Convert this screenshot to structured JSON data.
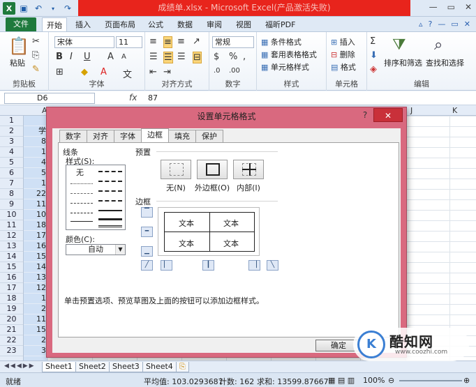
{
  "window": {
    "title": "成绩单.xlsx - Microsoft Excel(产品激活失败)"
  },
  "ribbon": {
    "file_tab": "文件",
    "tabs": [
      "开始",
      "插入",
      "页面布局",
      "公式",
      "数据",
      "审阅",
      "视图",
      "福昕PDF"
    ],
    "clipboard": {
      "paste": "粘贴",
      "label": "剪贴板"
    },
    "font": {
      "family": "宋体",
      "size": "11",
      "bold": "B",
      "italic": "I",
      "underline": "U",
      "grow": "A",
      "shrink": "A",
      "label": "字体"
    },
    "align": {
      "label": "对齐方式"
    },
    "number": {
      "format": "常规",
      "label": "数字"
    },
    "styles": {
      "conditional": "条件格式",
      "table": "套用表格格式",
      "cell": "单元格样式",
      "label": "样式"
    },
    "cells": {
      "insert": "插入",
      "delete": "删除",
      "format": "格式",
      "label": "单元格"
    },
    "edit": {
      "sort": "排序和筛选",
      "find": "查找和选择",
      "label": "编辑"
    }
  },
  "formula_bar": {
    "cell": "D6",
    "fx": "fx",
    "value": "87"
  },
  "sheet": {
    "columns": [
      "A",
      "J",
      "K"
    ],
    "rows": [
      "1",
      "2",
      "3",
      "4",
      "5",
      "6",
      "7",
      "8",
      "9",
      "10",
      "11",
      "12",
      "13",
      "14",
      "15",
      "16",
      "17",
      "18",
      "19",
      "20",
      "21",
      "22",
      "23"
    ],
    "col_a": [
      "",
      "学",
      "8",
      "1",
      "4",
      "5",
      "1",
      "22",
      "11",
      "10",
      "18",
      "17",
      "16",
      "15",
      "14",
      "13",
      "12",
      "1",
      "2",
      "11",
      "15",
      "2",
      "3"
    ],
    "tabs": [
      "Sheet1",
      "Sheet2",
      "Sheet3",
      "Sheet4"
    ]
  },
  "status": {
    "ready": "就绪",
    "average": "平均值: 103.0293687",
    "count": "计数: 162",
    "sum": "求和: 13599.87667",
    "zoom": "100%"
  },
  "dialog": {
    "title": "设置单元格格式",
    "help": "?",
    "close": "✕",
    "tabs": [
      "数字",
      "对齐",
      "字体",
      "边框",
      "填充",
      "保护"
    ],
    "active_tab": "边框",
    "line_section": "线条",
    "style_label": "样式(S):",
    "style_none": "无",
    "color_label": "颜色(C):",
    "color_value": "自动",
    "preset_section": "预置",
    "presets": [
      "无(N)",
      "外边框(O)",
      "内部(I)"
    ],
    "border_section": "边框",
    "preview_text": [
      "文本",
      "文本",
      "文本",
      "文本"
    ],
    "hint": "单击预置选项、预览草图及上面的按钮可以添加边框样式。",
    "ok": "确定"
  },
  "watermark": {
    "name": "酷知网",
    "url": "www.coozhi.com"
  },
  "colors": {
    "excel_green": "#1f7a3d",
    "title_red": "#e8241c",
    "dialog_frame": "#d9697f",
    "selection_blue": "#cfe0f5"
  }
}
